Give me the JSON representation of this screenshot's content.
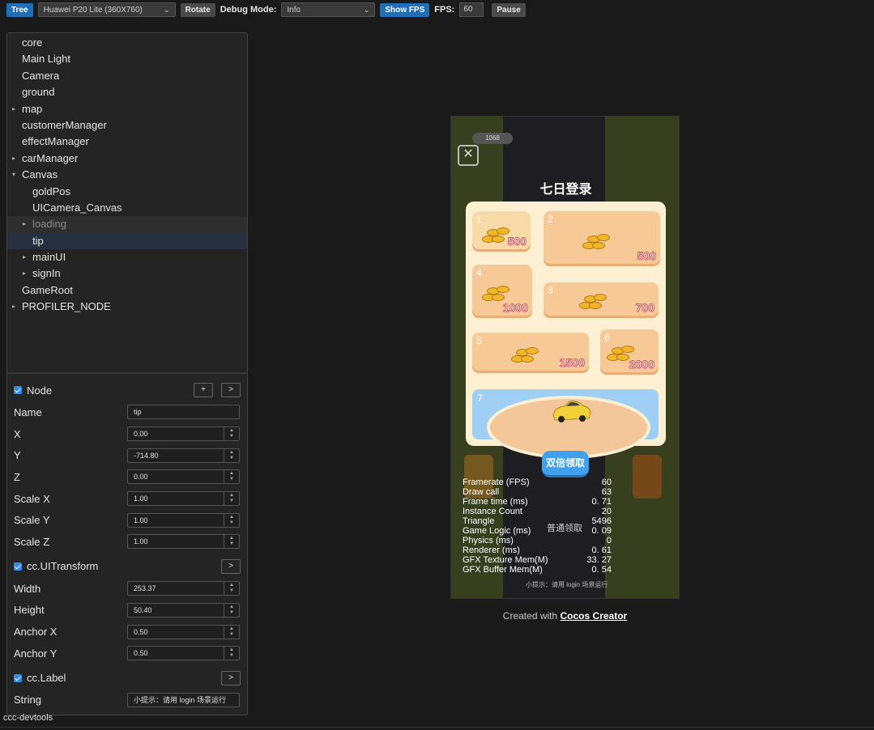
{
  "toolbar": {
    "tree_label": "Tree",
    "device_value": "Huawei P20 Lite (360X760)",
    "rotate_label": "Rotate",
    "debug_mode_label": "Debug Mode:",
    "debug_mode_value": "Info",
    "show_fps_label": "Show FPS",
    "fps_label": "FPS:",
    "fps_value": "60",
    "pause_label": "Pause"
  },
  "tree": {
    "items": [
      {
        "label": "core",
        "depth": 0,
        "arrow": ""
      },
      {
        "label": "Main Light",
        "depth": 0,
        "arrow": ""
      },
      {
        "label": "Camera",
        "depth": 0,
        "arrow": ""
      },
      {
        "label": "ground",
        "depth": 0,
        "arrow": ""
      },
      {
        "label": "map",
        "depth": 0,
        "arrow": "▸"
      },
      {
        "label": "customerManager",
        "depth": 0,
        "arrow": ""
      },
      {
        "label": "effectManager",
        "depth": 0,
        "arrow": ""
      },
      {
        "label": "carManager",
        "depth": 0,
        "arrow": "▸"
      },
      {
        "label": "Canvas",
        "depth": 0,
        "arrow": "▾"
      },
      {
        "label": "goldPos",
        "depth": 1,
        "arrow": ""
      },
      {
        "label": "UICamera_Canvas",
        "depth": 1,
        "arrow": ""
      },
      {
        "label": "loading",
        "depth": 1,
        "arrow": "▸"
      },
      {
        "label": "tip",
        "depth": 1,
        "arrow": ""
      },
      {
        "label": "mainUI",
        "depth": 1,
        "arrow": "▸"
      },
      {
        "label": "signIn",
        "depth": 1,
        "arrow": "▸"
      },
      {
        "label": "GameRoot",
        "depth": 0,
        "arrow": ""
      },
      {
        "label": "PROFILER_NODE",
        "depth": 0,
        "arrow": "▸"
      }
    ]
  },
  "node": {
    "title": "Node",
    "add_label": "+",
    "goto_label": ">",
    "name_label": "Name",
    "name_value": "tip",
    "x_label": "X",
    "x_value": "0.00",
    "y_label": "Y",
    "y_value": "-714.80",
    "z_label": "Z",
    "z_value": "0.00",
    "sx_label": "Scale X",
    "sx_value": "1.00",
    "sy_label": "Scale Y",
    "sy_value": "1.00",
    "sz_label": "Scale Z",
    "sz_value": "1.00"
  },
  "uitransform": {
    "title": "cc.UITransform",
    "goto_label": ">",
    "width_label": "Width",
    "width_value": "253.37",
    "height_label": "Height",
    "height_value": "50.40",
    "ax_label": "Anchor X",
    "ax_value": "0.50",
    "ay_label": "Anchor Y",
    "ay_value": "0.50"
  },
  "label": {
    "title": "cc.Label",
    "goto_label": ">",
    "string_label": "String",
    "string_value": "小提示：请用 login 场景运行"
  },
  "footer": {
    "devtools_label": "ccc-devtools"
  },
  "game": {
    "title": "七日登录",
    "score": "1068",
    "close_icon": "✕",
    "days": [
      {
        "n": "1",
        "amount": "500"
      },
      {
        "n": "2",
        "amount": "500"
      },
      {
        "n": "4",
        "amount": "1000"
      },
      {
        "n": "3",
        "amount": "700"
      },
      {
        "n": "5",
        "amount": "1500"
      },
      {
        "n": "6",
        "amount": "2000"
      },
      {
        "n": "7",
        "amount": ""
      }
    ],
    "double_claim": "双倍领取",
    "normal_claim": "普通领取",
    "hint": "小提示：请用 login 场景运行",
    "colors": {
      "panel": "#fdf0d2",
      "tile": "#f6c996",
      "button": "#3fa0ec",
      "amount_stroke": "#d0556a"
    }
  },
  "stats": [
    {
      "label": "Framerate (FPS)",
      "value": "60"
    },
    {
      "label": "Draw call",
      "value": "63"
    },
    {
      "label": "Frame time (ms)",
      "value": "0. 71"
    },
    {
      "label": "Instance Count",
      "value": "20"
    },
    {
      "label": "Triangle",
      "value": "5496"
    },
    {
      "label": "Game Logic (ms)",
      "value": "0. 09"
    },
    {
      "label": "Physics (ms)",
      "value": "0"
    },
    {
      "label": "Renderer (ms)",
      "value": "0. 61"
    },
    {
      "label": "GFX Texture Mem(M)",
      "value": "33. 27"
    },
    {
      "label": "GFX Buffer Mem(M)",
      "value": "0. 54"
    }
  ],
  "created": {
    "prefix": "Created with",
    "link": "Cocos Creator"
  }
}
